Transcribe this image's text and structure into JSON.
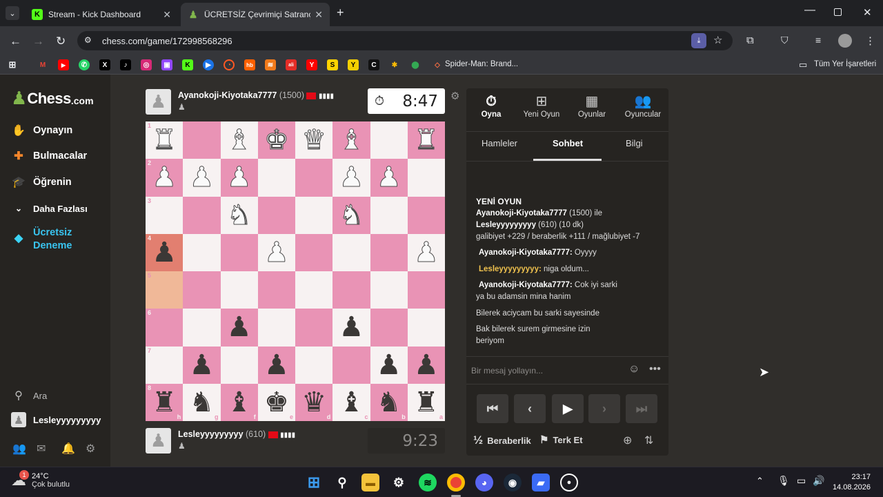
{
  "browser": {
    "tabs": [
      {
        "title": "Stream - Kick Dashboard",
        "icon": "kick-icon",
        "active": false
      },
      {
        "title": "ÜCRETSİZ Çevrimiçi Satranç Oy",
        "icon": "chess-pawn-icon",
        "active": true
      }
    ],
    "url": "chess.com/game/172998568296",
    "bookmarks_overflow_label": "Spider-Man: Brand...",
    "all_bookmarks_label": "Tüm Yer İşaretleri"
  },
  "sidebar": {
    "logo_main": "Chess",
    "logo_suffix": ".com",
    "items": [
      {
        "label": "Oynayın"
      },
      {
        "label": "Bulmacalar"
      },
      {
        "label": "Öğrenin"
      },
      {
        "label": "Daha Fazlası"
      },
      {
        "label": "Ücretsiz Deneme"
      }
    ],
    "search_label": "Ara",
    "username": "Lesleyyyyyyyyy"
  },
  "top_player": {
    "name": "Ayanokoji-Kiyotaka7777",
    "rating": "(1500)",
    "clock": "8:47"
  },
  "bottom_player": {
    "name": "Lesleyyyyyyyyy",
    "rating": "(610)",
    "clock": "9:23"
  },
  "board": {
    "ranks": [
      "1",
      "2",
      "3",
      "4",
      "5",
      "6",
      "7",
      "8"
    ],
    "files": [
      "h",
      "g",
      "f",
      "e",
      "d",
      "c",
      "b",
      "a"
    ],
    "rows": [
      [
        "wR",
        "",
        "wB",
        "wK",
        "wQ",
        "wB",
        "",
        "wR"
      ],
      [
        "wP",
        "wP",
        "wP",
        "",
        "",
        "wP",
        "wP",
        ""
      ],
      [
        "",
        "",
        "wN",
        "",
        "",
        "wN",
        "",
        ""
      ],
      [
        "bP",
        "",
        "",
        "wP",
        "",
        "",
        "",
        "wP"
      ],
      [
        "",
        "",
        "",
        "",
        "",
        "",
        "",
        ""
      ],
      [
        "",
        "",
        "bP",
        "",
        "",
        "bP",
        "",
        ""
      ],
      [
        "",
        "bP",
        "",
        "bP",
        "",
        "",
        "bP",
        "bP"
      ],
      [
        "bR",
        "bN",
        "bB",
        "bK",
        "bQ",
        "bB",
        "bN",
        "bR"
      ]
    ],
    "light_color": "#f7f2f2",
    "dark_color": "#e993b5",
    "last_move_from": "#f0b898",
    "last_move_to": "#e27f70"
  },
  "panel": {
    "top_tabs": [
      {
        "label": "Oyna",
        "icon": "clock-icon"
      },
      {
        "label": "Yeni Oyun",
        "icon": "plus-icon"
      },
      {
        "label": "Oyunlar",
        "icon": "board-icon"
      },
      {
        "label": "Oyuncular",
        "icon": "players-icon"
      }
    ],
    "sub_tabs": [
      "Hamleler",
      "Sohbet",
      "Bilgi"
    ],
    "new_game_title": "YENİ OYUN",
    "new_game_line1_name": "Ayanokoji-Kiyotaka7777",
    "new_game_line1_rest": "(1500) ile",
    "new_game_line2_name": "Lesleyyyyyyyyy",
    "new_game_line2_rest": "(610) (10 dk)",
    "new_game_line3": "galibiyet +229 / beraberlik +111 / mağlubiyet -7",
    "messages": [
      {
        "author": "Ayanokoji-Kiyotaka7777:",
        "text": "Oyyyy"
      },
      {
        "author": "Lesleyyyyyyyyy:",
        "text": "niga oldum..."
      },
      {
        "author": "Ayanokoji-Kiyotaka7777:",
        "text": "Cok iyi sarki"
      },
      {
        "author": "",
        "text": "ya bu adamsin mina hanim"
      },
      {
        "author": "",
        "text": "Bilerek aciycam bu sarki sayesinde"
      },
      {
        "author": "",
        "text": "Bak bilerek surem girmesine izin"
      },
      {
        "author": "",
        "text": "beriyom"
      }
    ],
    "chat_placeholder": "Bir mesaj yollayın...",
    "draw_label": "Beraberlik",
    "resign_label": "Terk Et"
  },
  "taskbar": {
    "weather_temp": "24°C",
    "weather_desc": "Çok bulutlu",
    "weather_badge": "1",
    "time": "23:17",
    "date": "14.08.2026"
  }
}
